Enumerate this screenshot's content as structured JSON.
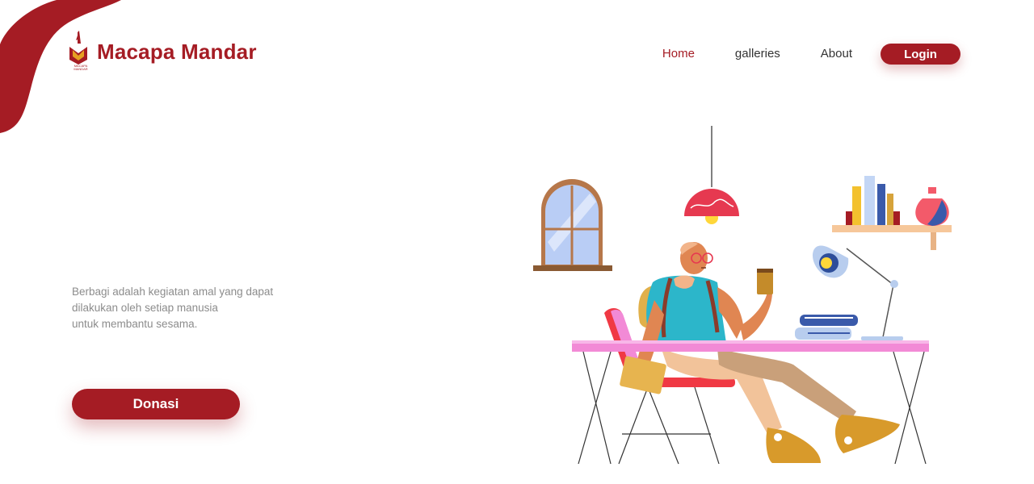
{
  "brand": {
    "name": "Macapa Mandar",
    "sub_label": "MACAPA MANDAR",
    "primary_color": "#a51c24"
  },
  "nav": {
    "items": [
      {
        "label": "Home",
        "active": true
      },
      {
        "label": "galleries",
        "active": false
      },
      {
        "label": "About",
        "active": false
      }
    ],
    "login_label": "Login"
  },
  "hero": {
    "lines": [
      "Berbagi adalah kegiatan amal yang dapat",
      "dilakukan oleh setiap manusia",
      "untuk membantu sesama."
    ],
    "cta_label": "Donasi"
  },
  "illustration": {
    "subject": "person-sitting-at-desk",
    "icons": [
      "window-icon",
      "pendant-lamp-icon",
      "bookshelf-icon",
      "vase-icon",
      "desk-lamp-icon",
      "books-icon",
      "coffee-cup-icon",
      "chair-icon",
      "desk-icon"
    ]
  }
}
